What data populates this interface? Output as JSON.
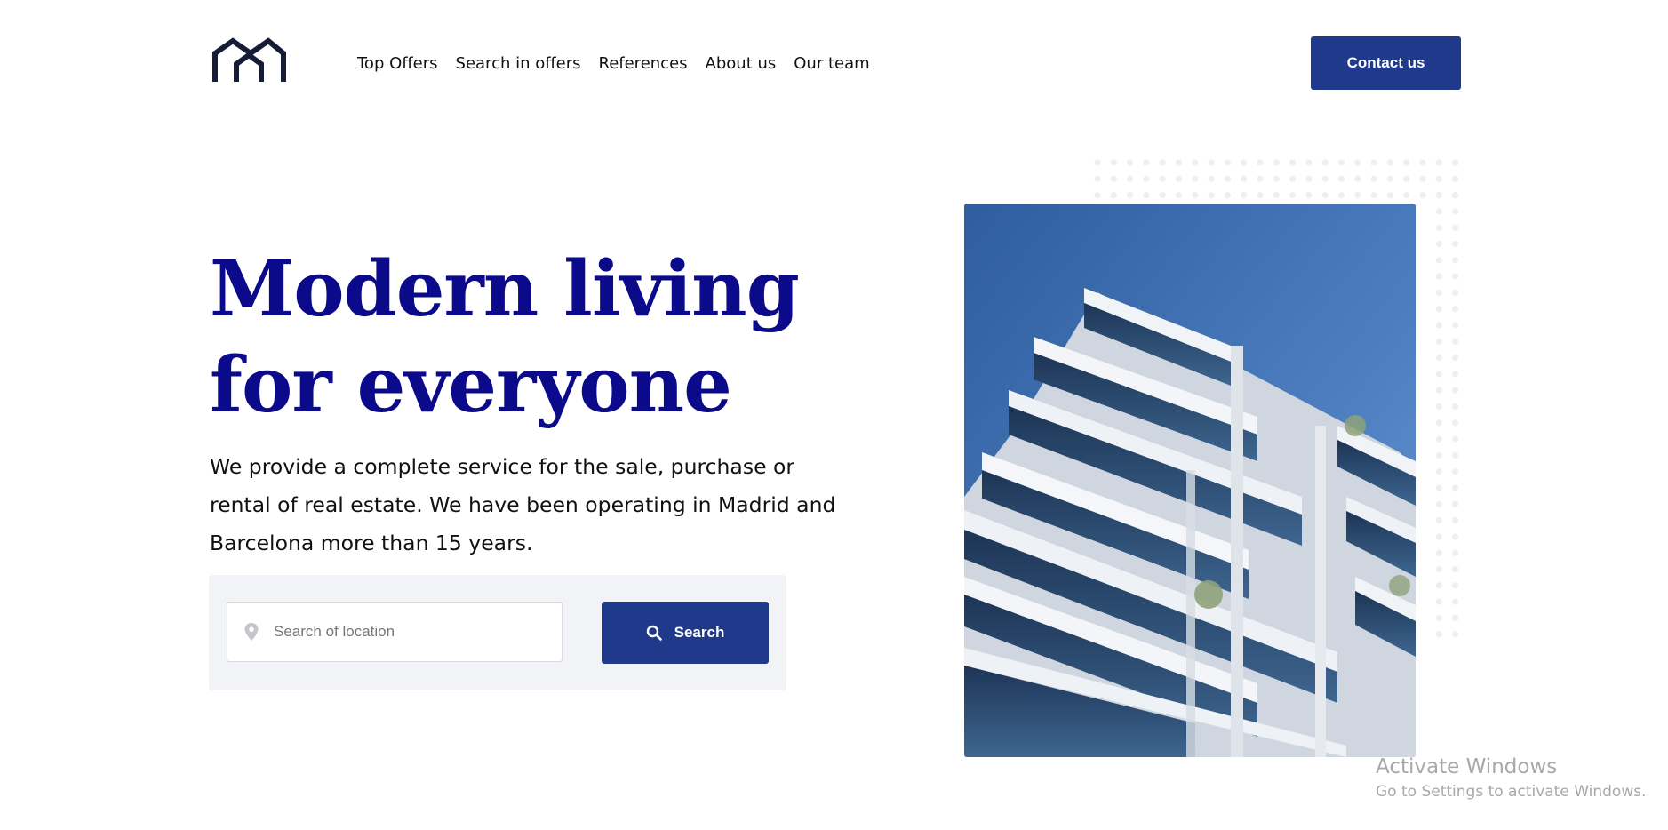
{
  "header": {
    "logo_icon": "house-outline-logo-icon",
    "nav": [
      {
        "label": "Top Offers"
      },
      {
        "label": "Search in offers"
      },
      {
        "label": "References"
      },
      {
        "label": "About us"
      },
      {
        "label": "Our team"
      }
    ],
    "contact_label": "Contact us"
  },
  "hero": {
    "headline_line1": "Modern living",
    "headline_line2": "for everyone",
    "description": "We provide a complete service for the sale, purchase or rental of real estate. We have been operating in Madrid and Barcelona more than 15 years.",
    "search": {
      "placeholder": "Search of location",
      "value": "",
      "location_icon": "location-pin-icon",
      "button_icon": "search-icon",
      "button_label": "Search"
    },
    "image_icon": "modern-apartment-building-photo"
  },
  "watermark": {
    "title": "Activate Windows",
    "subtitle": "Go to Settings to activate Windows."
  },
  "colors": {
    "brand_blue": "#1f3a8a",
    "headline_blue": "#0a0a8a",
    "panel_bg": "#f2f3f7",
    "logo": "#141c36"
  }
}
